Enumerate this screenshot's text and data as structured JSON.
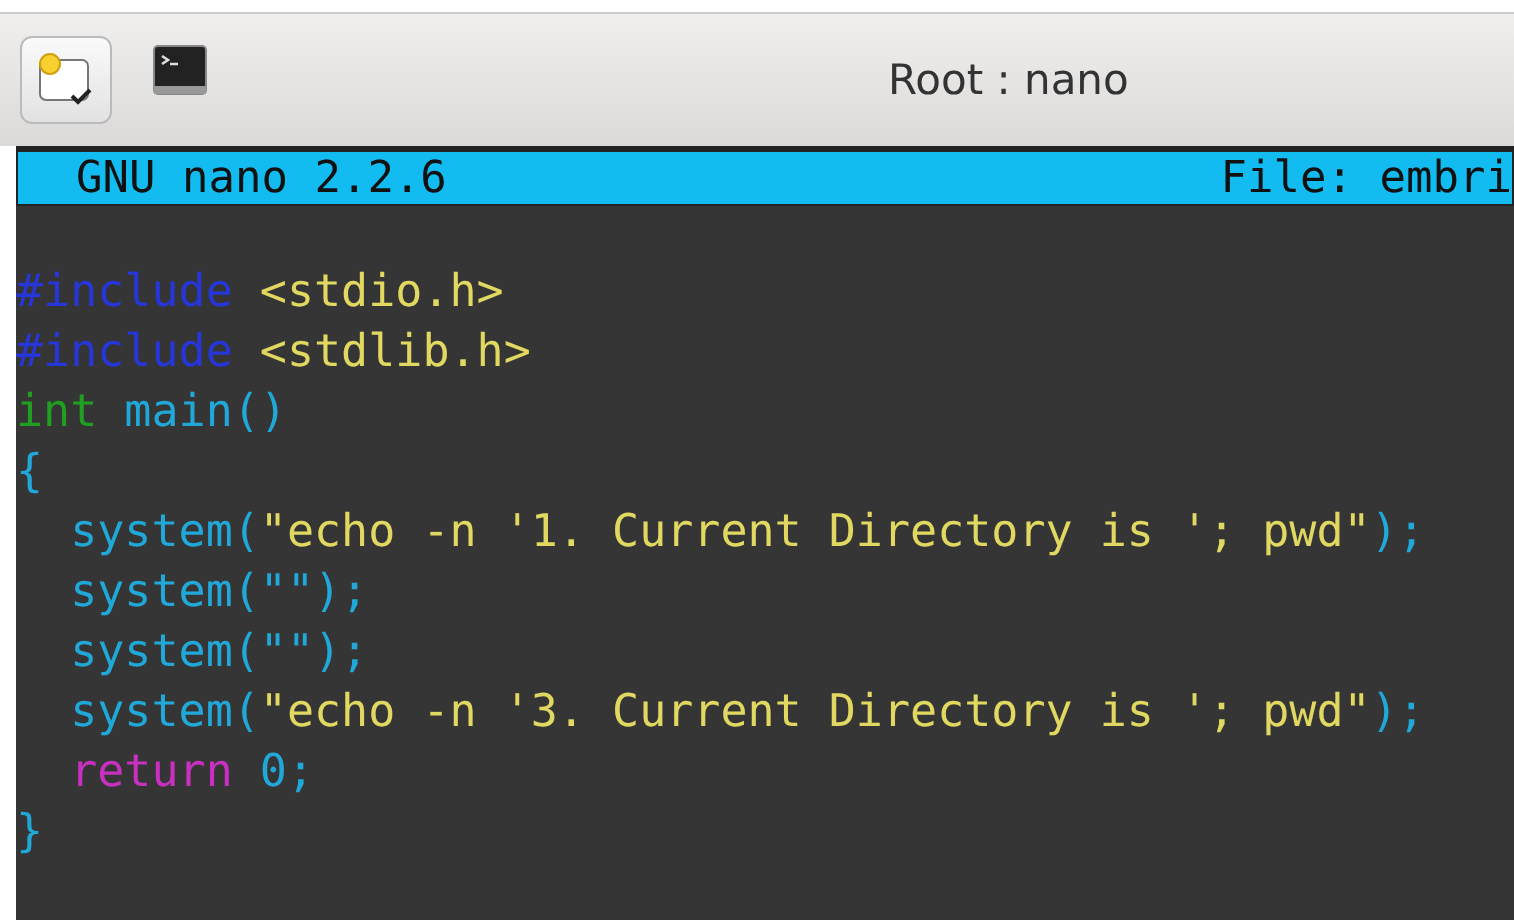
{
  "window": {
    "title": "Root : nano"
  },
  "header": {
    "app": "GNU nano 2.2.6",
    "file": "File: embri"
  },
  "code_lines": [
    [
      {
        "text": "#include",
        "kind": "preprocessor"
      },
      {
        "text": " <stdio.h>",
        "kind": "string"
      }
    ],
    [
      {
        "text": "#include",
        "kind": "preprocessor"
      },
      {
        "text": " <stdlib.h>",
        "kind": "string"
      }
    ],
    [
      {
        "text": "int",
        "kind": "type"
      },
      {
        "text": " main()",
        "kind": "identifier"
      }
    ],
    [
      {
        "text": "{",
        "kind": "identifier"
      }
    ],
    [
      {
        "text": "  system(",
        "kind": "identifier"
      },
      {
        "text": "\"echo -n '1. Current Directory is '; pwd\"",
        "kind": "string"
      },
      {
        "text": ");",
        "kind": "identifier"
      }
    ],
    [
      {
        "text": "  system(\"\");",
        "kind": "identifier"
      }
    ],
    [
      {
        "text": "  system(\"\");",
        "kind": "identifier"
      }
    ],
    [
      {
        "text": "  system(",
        "kind": "identifier"
      },
      {
        "text": "\"echo -n '3. Current Directory is '; pwd\"",
        "kind": "string"
      },
      {
        "text": ");",
        "kind": "identifier"
      }
    ],
    [
      {
        "text": "  return",
        "kind": "keyword"
      },
      {
        "text": " 0;",
        "kind": "identifier"
      }
    ],
    [
      {
        "text": "}",
        "kind": "identifier"
      }
    ]
  ]
}
